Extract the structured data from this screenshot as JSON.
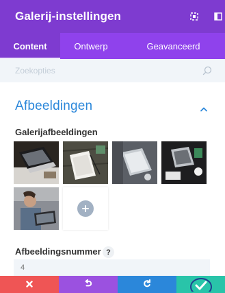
{
  "header": {
    "title": "Galerij-instellingen",
    "icons": [
      "expand-icon",
      "split-view-icon"
    ]
  },
  "tabs": [
    {
      "label": "Content",
      "active": true
    },
    {
      "label": "Ontwerp",
      "active": false
    },
    {
      "label": "Geavanceerd",
      "active": false
    }
  ],
  "search": {
    "placeholder": "Zoekopties",
    "value": ""
  },
  "section": {
    "title": "Afbeeldingen",
    "expanded": true
  },
  "gallery": {
    "label": "Galerijafbeeldingen",
    "images": [
      {
        "description": "laptop-on-desk"
      },
      {
        "description": "notebook-on-wood"
      },
      {
        "description": "laptop-on-dark-desk"
      },
      {
        "description": "dark-workspace"
      },
      {
        "description": "person-with-laptop"
      }
    ],
    "add_icon": "plus-icon"
  },
  "image_number": {
    "label": "Afbeeldingsnummer",
    "help": "?",
    "placeholder": "4"
  },
  "footer": {
    "buttons": [
      {
        "name": "discard",
        "icon": "close-icon",
        "color": "#ef5555"
      },
      {
        "name": "undo",
        "icon": "undo-icon",
        "color": "#9b51e0"
      },
      {
        "name": "redo",
        "icon": "redo-icon",
        "color": "#2b87da"
      },
      {
        "name": "save",
        "icon": "check-icon",
        "color": "#29c4a9"
      }
    ]
  },
  "colors": {
    "header": "#7e3bd0",
    "tabs": "#8f42ec",
    "accent": "#2b87da"
  }
}
